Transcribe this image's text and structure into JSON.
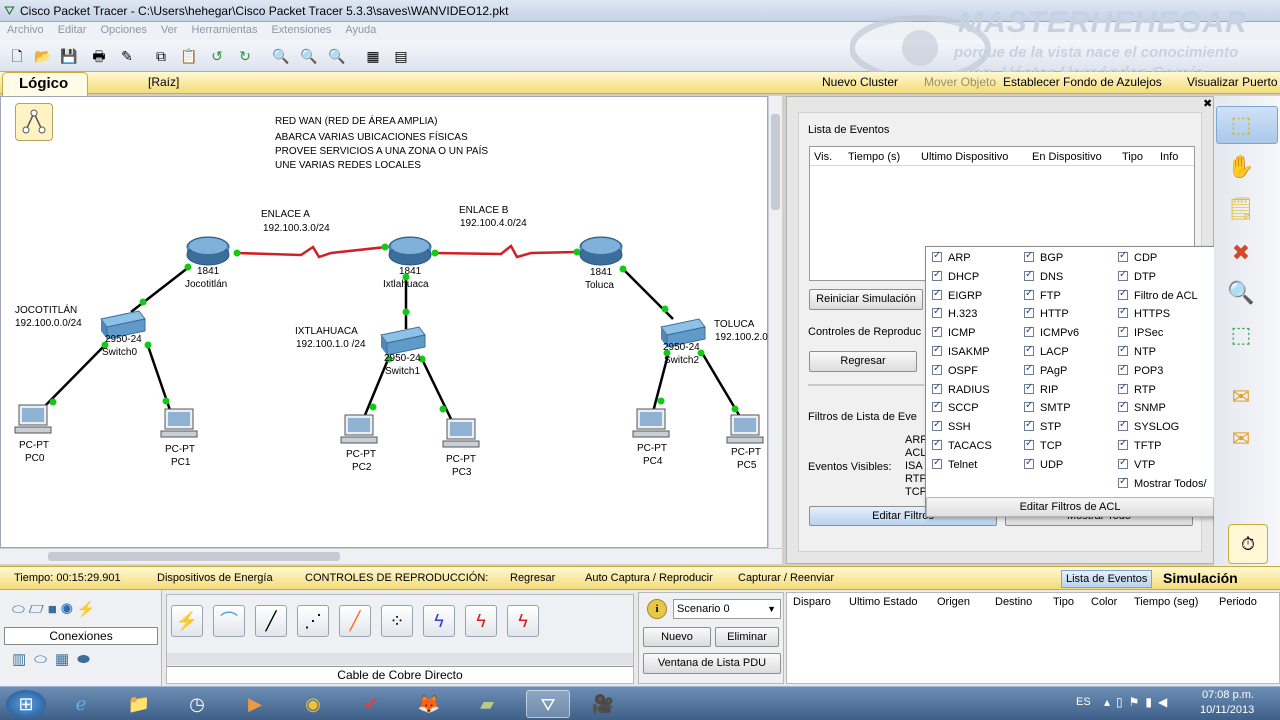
{
  "window": {
    "title": "Cisco Packet Tracer - C:\\Users\\hehegar\\Cisco Packet Tracer 5.3.3\\saves\\WANVIDEO12.pkt"
  },
  "menu": [
    "Archivo",
    "Editar",
    "Opciones",
    "Ver",
    "Herramientas",
    "Extensiones",
    "Ayuda"
  ],
  "watermark": {
    "line1": "MASTERHEHEGAR",
    "line2": "porque de la vista nace el conocimiento",
    "line3": "Ing. Héctor Hernández García"
  },
  "logicbar": {
    "tab": "Lógico",
    "root": "[Raíz]",
    "new_cluster": "Nuevo Cluster",
    "move_object": "Mover Objeto",
    "set_background": "Establecer Fondo de Azulejos",
    "viewport": "Visualizar Puerto"
  },
  "canvas": {
    "notes": [
      "RED WAN  (RED DE ÁREA AMPLIA)",
      "ABARCA VARIAS UBICACIONES FÍSICAS",
      "PROVEE SERVICIOS A UNA ZONA O UN PAÍS",
      "UNE VARIAS REDES LOCALES"
    ],
    "link_a": {
      "name": "ENLACE A",
      "net": "192.100.3.0/24"
    },
    "link_b": {
      "name": "ENLACE B",
      "net": "192.100.4.0/24"
    },
    "routers": [
      {
        "model": "1841",
        "name": "Jocotitlán"
      },
      {
        "model": "1841",
        "name": "Ixtlahuaca"
      },
      {
        "model": "1841",
        "name": "Toluca"
      }
    ],
    "lans": [
      {
        "name": "JOCOTITLÁN",
        "net": "192.100.0.0/24"
      },
      {
        "name": "IXTLAHUACA",
        "net": "192.100.1.0 /24"
      },
      {
        "name": "TOLUCA",
        "net": "192.100.2.0"
      }
    ],
    "switches": [
      {
        "model": "2950-24",
        "name": "Switch0"
      },
      {
        "model": "2950-24",
        "name": "Switch1"
      },
      {
        "model": "2950-24",
        "name": "Switch2"
      }
    ],
    "pcs": [
      {
        "type": "PC-PT",
        "name": "PC0"
      },
      {
        "type": "PC-PT",
        "name": "PC1"
      },
      {
        "type": "PC-PT",
        "name": "PC2"
      },
      {
        "type": "PC-PT",
        "name": "PC3"
      },
      {
        "type": "PC-PT",
        "name": "PC4"
      },
      {
        "type": "PC-PT",
        "name": "PC5"
      }
    ]
  },
  "events": {
    "title": "Lista de Eventos",
    "columns": [
      "Vis.",
      "Tiempo (s)",
      "Ultimo Dispositivo",
      "En Dispositivo",
      "Tipo",
      "Info"
    ],
    "reset_button": "Reiniciar Simulación",
    "playback_title": "Controles de Reproduc",
    "back_button": "Regresar",
    "filters_title": "Filtros de Lista de Eve",
    "visible_label": "Eventos Visibles:",
    "visible_values": [
      "ARP",
      "ACL",
      "ISA",
      "RTP",
      "TCP"
    ],
    "edit_filters_button": "Editar Filtros",
    "show_all_button": "Mostrar Todo"
  },
  "filter_popup": {
    "col1": [
      "ARP",
      "DHCP",
      "EIGRP",
      "H.323",
      "ICMP",
      "ISAKMP",
      "OSPF",
      "RADIUS",
      "SCCP",
      "SSH",
      "TACACS",
      "Telnet"
    ],
    "col2": [
      "BGP",
      "DNS",
      "FTP",
      "HTTP",
      "ICMPv6",
      "LACP",
      "PAgP",
      "RIP",
      "SMTP",
      "STP",
      "TCP",
      "UDP"
    ],
    "col3": [
      "CDP",
      "DTP",
      "Filtro de ACL",
      "HTTPS",
      "IPSec",
      "NTP",
      "POP3",
      "RTP",
      "SNMP",
      "SYSLOG",
      "TFTP",
      "VTP",
      "Mostrar Todos/"
    ],
    "acl_button": "Editar Filtros de ACL"
  },
  "statusbar": {
    "time": "Tiempo: 00:15:29.901",
    "power": "Dispositivos de Energía",
    "controls": "CONTROLES DE REPRODUCCIÓN:",
    "back": "Regresar",
    "auto": "Auto Captura / Reproducir",
    "capture": "Capturar / Reenviar",
    "event_list": "Lista de Eventos",
    "mode": "Simulación"
  },
  "bottom": {
    "category": "Conexiones",
    "cable": "Cable de Cobre Directo",
    "scenario": "Scenario 0",
    "new": "Nuevo",
    "delete": "Eliminar",
    "pdu_window": "Ventana de Lista PDU",
    "pdu_columns": [
      "Disparo",
      "Ultimo Estado",
      "Origen",
      "Destino",
      "Tipo",
      "Color",
      "Tiempo (seg)",
      "Periodo"
    ]
  },
  "taskbar": {
    "lang": "ES",
    "time": "07:08 p.m.",
    "date": "10/11/2013"
  },
  "colors": {
    "wan_link": "#d21f26",
    "lan_link": "#000000",
    "link_up": "#14c814",
    "accent": "#f3dc7a"
  }
}
